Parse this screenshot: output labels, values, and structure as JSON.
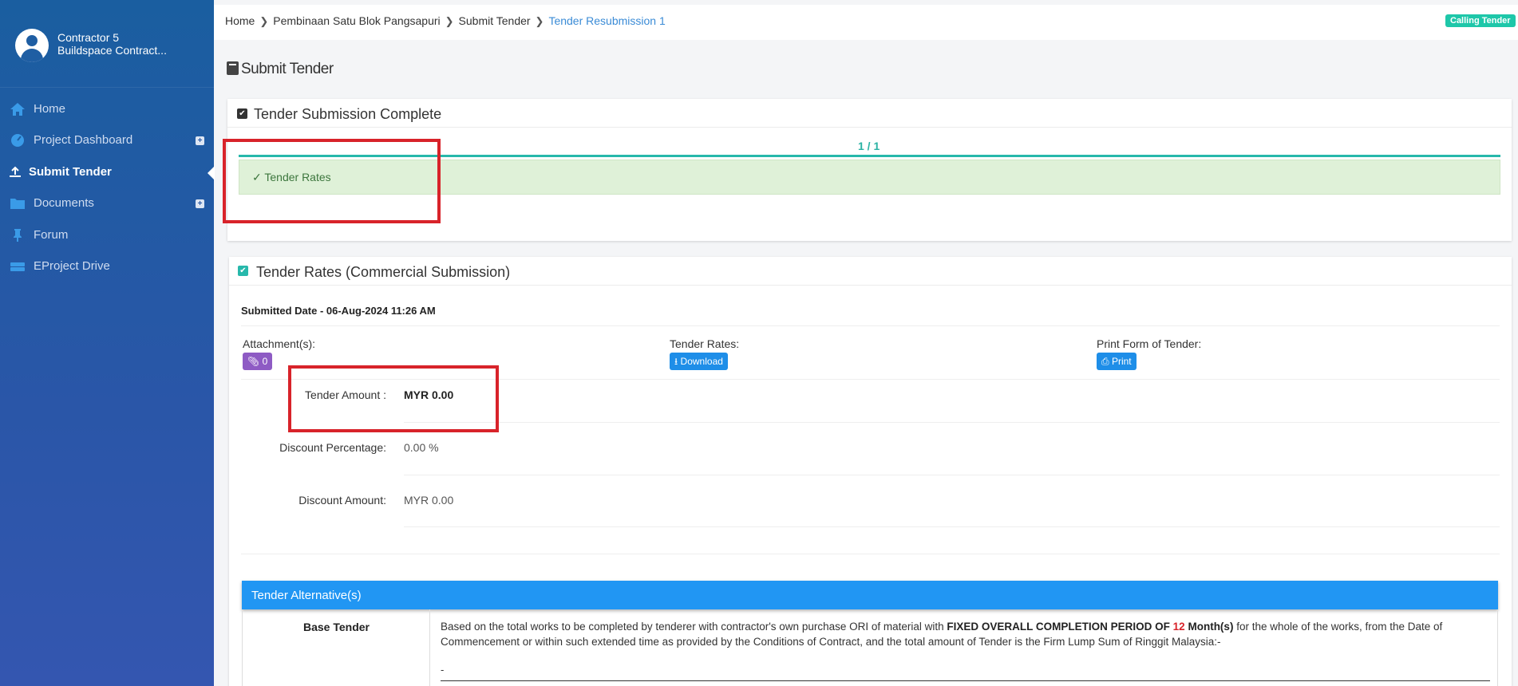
{
  "sidebar": {
    "user_name": "Contractor 5",
    "company": "Buildspace Contract...",
    "items": [
      {
        "label": "Home",
        "icon": "home-icon"
      },
      {
        "label": "Project Dashboard",
        "icon": "dashboard-icon",
        "expand": "+"
      },
      {
        "label": "Submit Tender",
        "icon": "upload-icon"
      },
      {
        "label": "Documents",
        "icon": "folder-icon",
        "expand": "+"
      },
      {
        "label": "Forum",
        "icon": "pin-icon"
      },
      {
        "label": "EProject Drive",
        "icon": "drive-icon"
      }
    ]
  },
  "breadcrumb": {
    "items": [
      "Home",
      "Pembinaan Satu Blok Pangsapuri",
      "Submit Tender"
    ],
    "current": "Tender Resubmission 1"
  },
  "status_badge": "Calling Tender",
  "page_title": "Submit Tender",
  "completion_card": {
    "title": "Tender Submission Complete",
    "progress": "1 / 1",
    "step": "Tender Rates"
  },
  "rates_card": {
    "title": "Tender Rates (Commercial Submission)",
    "submitted": "Submitted Date - 06-Aug-2024 11:26 AM",
    "attachments_label": "Attachment(s):",
    "attachments_count": "0",
    "tender_rates_label": "Tender Rates:",
    "download_label": "Download",
    "print_form_label": "Print Form of Tender:",
    "print_label": "Print",
    "tender_amount_label": "Tender Amount :",
    "tender_amount": "MYR 0.00",
    "discount_pct_label": "Discount Percentage:",
    "discount_pct": "0.00 %",
    "discount_amt_label": "Discount Amount:",
    "discount_amt": "MYR 0.00"
  },
  "alternatives": {
    "header": "Tender Alternative(s)",
    "base_label": "Base Tender",
    "desc_part1": "Based on the total works to be completed by tenderer with contractor's own purchase ORI of material with ",
    "desc_bold1": "FIXED OVERALL COMPLETION PERIOD OF ",
    "desc_months": "12",
    "desc_bold2": " Month(s)",
    "desc_part2": " for the whole of the works, from the Date of Commencement or within such extended time as provided by the Conditions of Contract, and the total amount of Tender is the Firm Lump Sum of Ringgit Malaysia:-",
    "amount_line": "-"
  },
  "colors": {
    "sidebar": "#2a56a8",
    "accent_teal": "#27b8ab",
    "highlight_red": "#d8232a",
    "alt_header": "#2196f3"
  }
}
